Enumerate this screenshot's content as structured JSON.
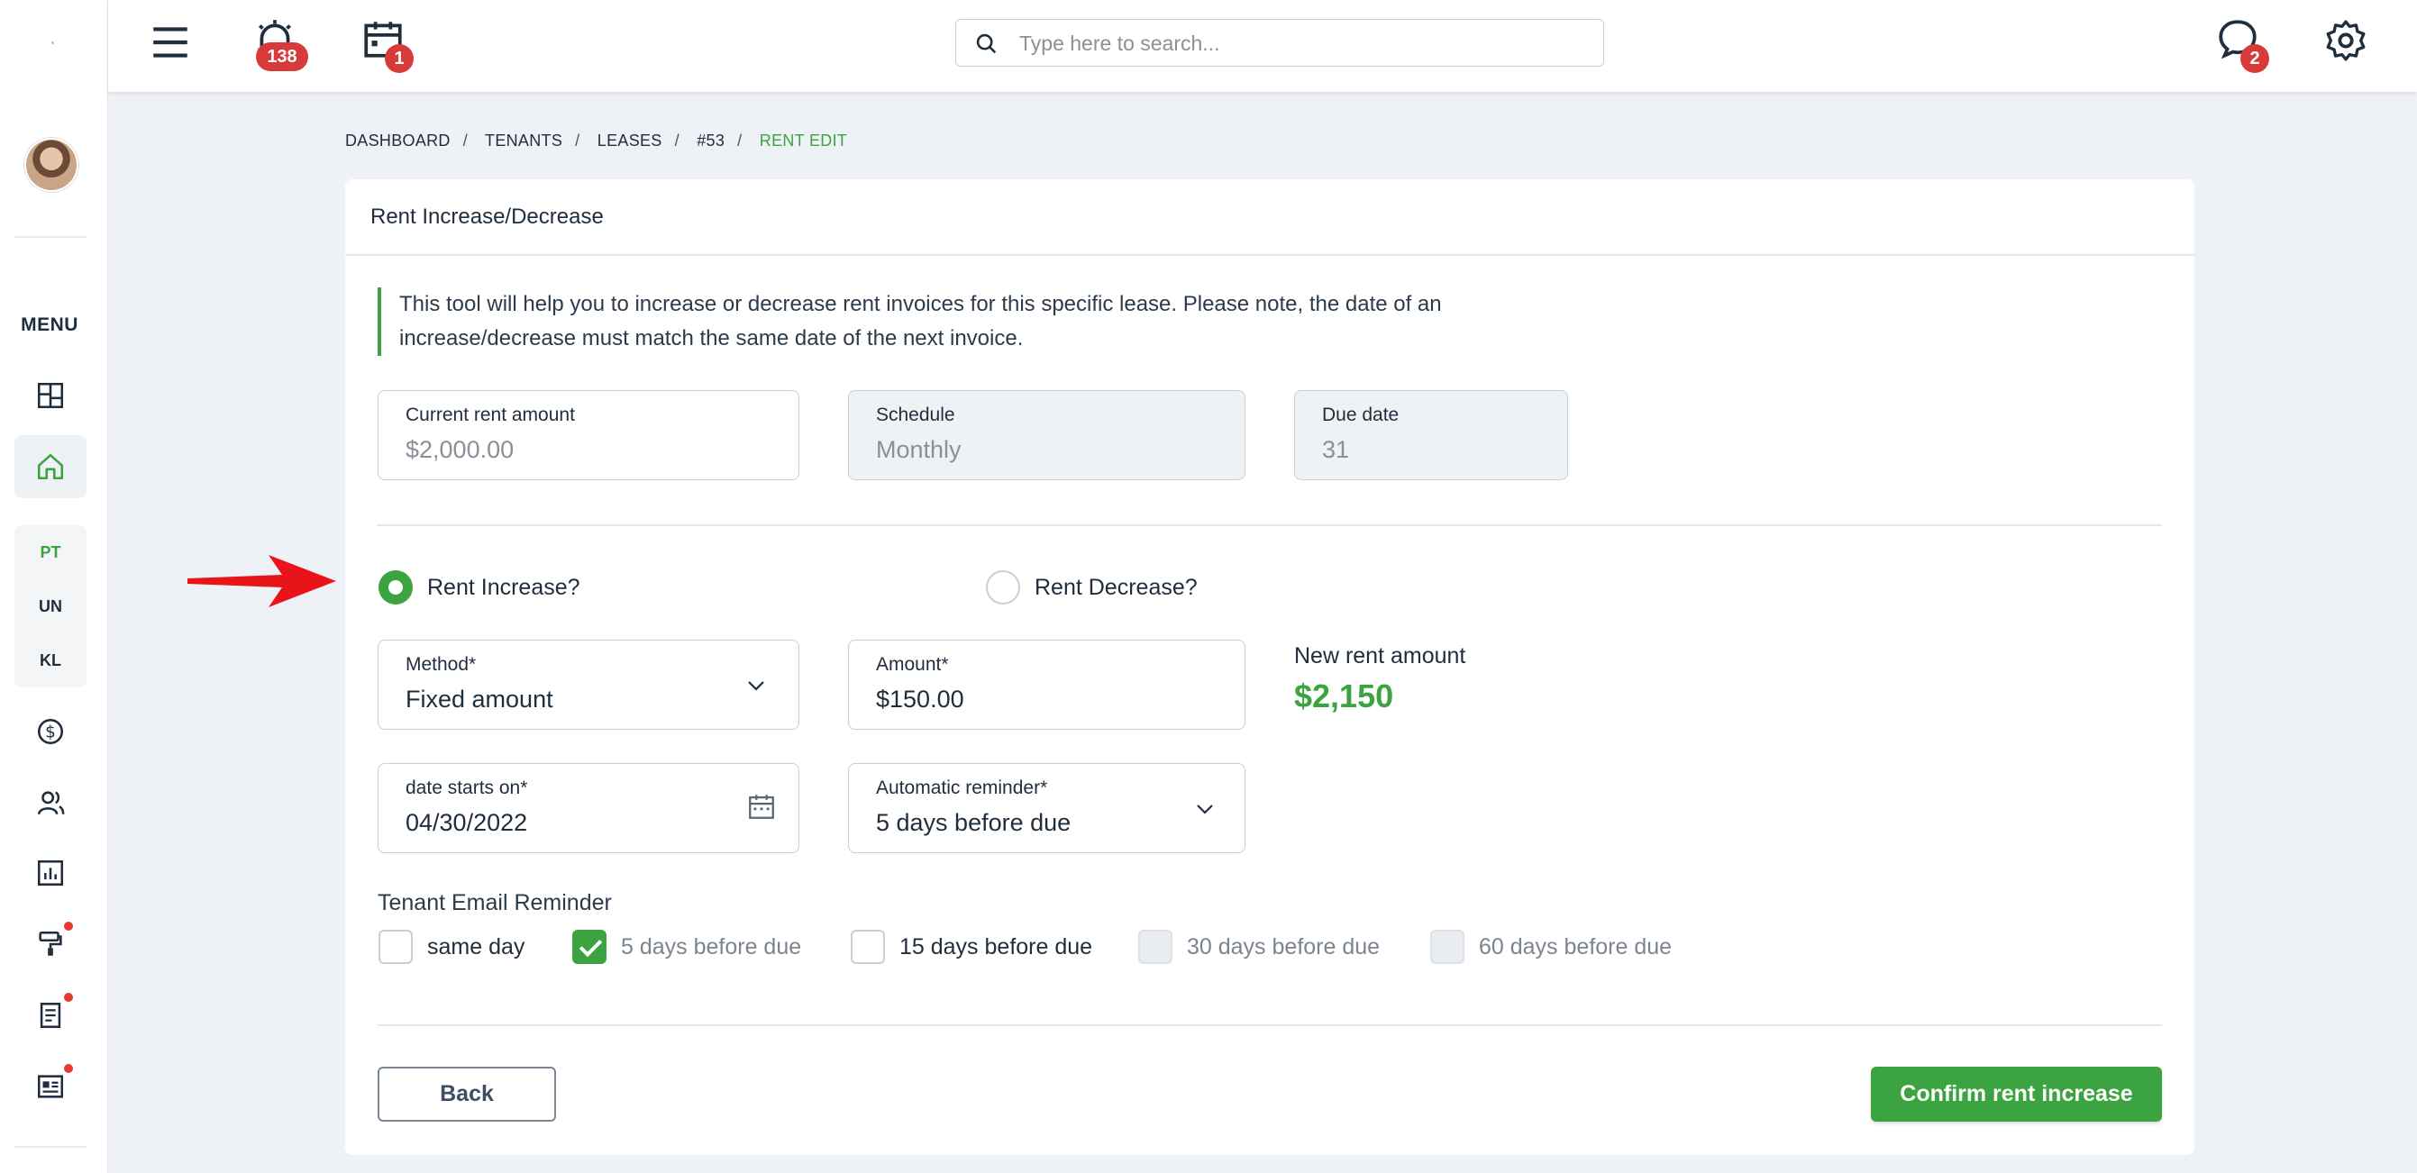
{
  "topbar": {
    "alarm_badge": "138",
    "calendar_badge": "1",
    "chat_badge": "2",
    "search_placeholder": "Type here to search..."
  },
  "sidebar": {
    "menu_label": "MENU",
    "sub_items": [
      "PT",
      "UN",
      "KL"
    ],
    "icons": [
      "dashboard-icon",
      "home-icon",
      "dollar-icon",
      "users-icon",
      "chart-icon",
      "paint-roller-icon",
      "document-icon",
      "newspaper-icon"
    ]
  },
  "breadcrumb": {
    "items": [
      "DASHBOARD",
      "TENANTS",
      "LEASES",
      "#53"
    ],
    "current": "RENT EDIT"
  },
  "card": {
    "title": "Rent Increase/Decrease",
    "notice": "This tool will help you to increase or decrease rent invoices for this specific lease. Please note, the date of an increase/decrease must match the same date of the next invoice."
  },
  "current_rent": {
    "label": "Current rent amount",
    "value": "$2,000.00"
  },
  "schedule": {
    "label": "Schedule",
    "value": "Monthly"
  },
  "due_date": {
    "label": "Due date",
    "value": "31"
  },
  "radio": {
    "increase_label": "Rent Increase?",
    "decrease_label": "Rent Decrease?",
    "selected": "increase"
  },
  "method": {
    "label": "Method*",
    "value": "Fixed amount"
  },
  "amount": {
    "label": "Amount*",
    "value": "$150.00"
  },
  "new_rent": {
    "label": "New rent amount",
    "value": "$2,150"
  },
  "date_starts": {
    "label": "date starts on*",
    "value": "04/30/2022"
  },
  "reminder": {
    "label": "Automatic reminder*",
    "value": "5 days before due"
  },
  "email_reminder": {
    "label": "Tenant Email Reminder",
    "options": [
      {
        "label": "same day",
        "checked": false,
        "disabled": false
      },
      {
        "label": "5 days before due",
        "checked": true,
        "disabled": false
      },
      {
        "label": "15 days before due",
        "checked": false,
        "disabled": false
      },
      {
        "label": "30 days before due",
        "checked": false,
        "disabled": true
      },
      {
        "label": "60 days before due",
        "checked": false,
        "disabled": true
      }
    ]
  },
  "buttons": {
    "back": "Back",
    "confirm": "Confirm rent increase"
  },
  "colors": {
    "accent": "#3ba440",
    "badge": "#d83a3a",
    "arrow": "#e8141a"
  }
}
